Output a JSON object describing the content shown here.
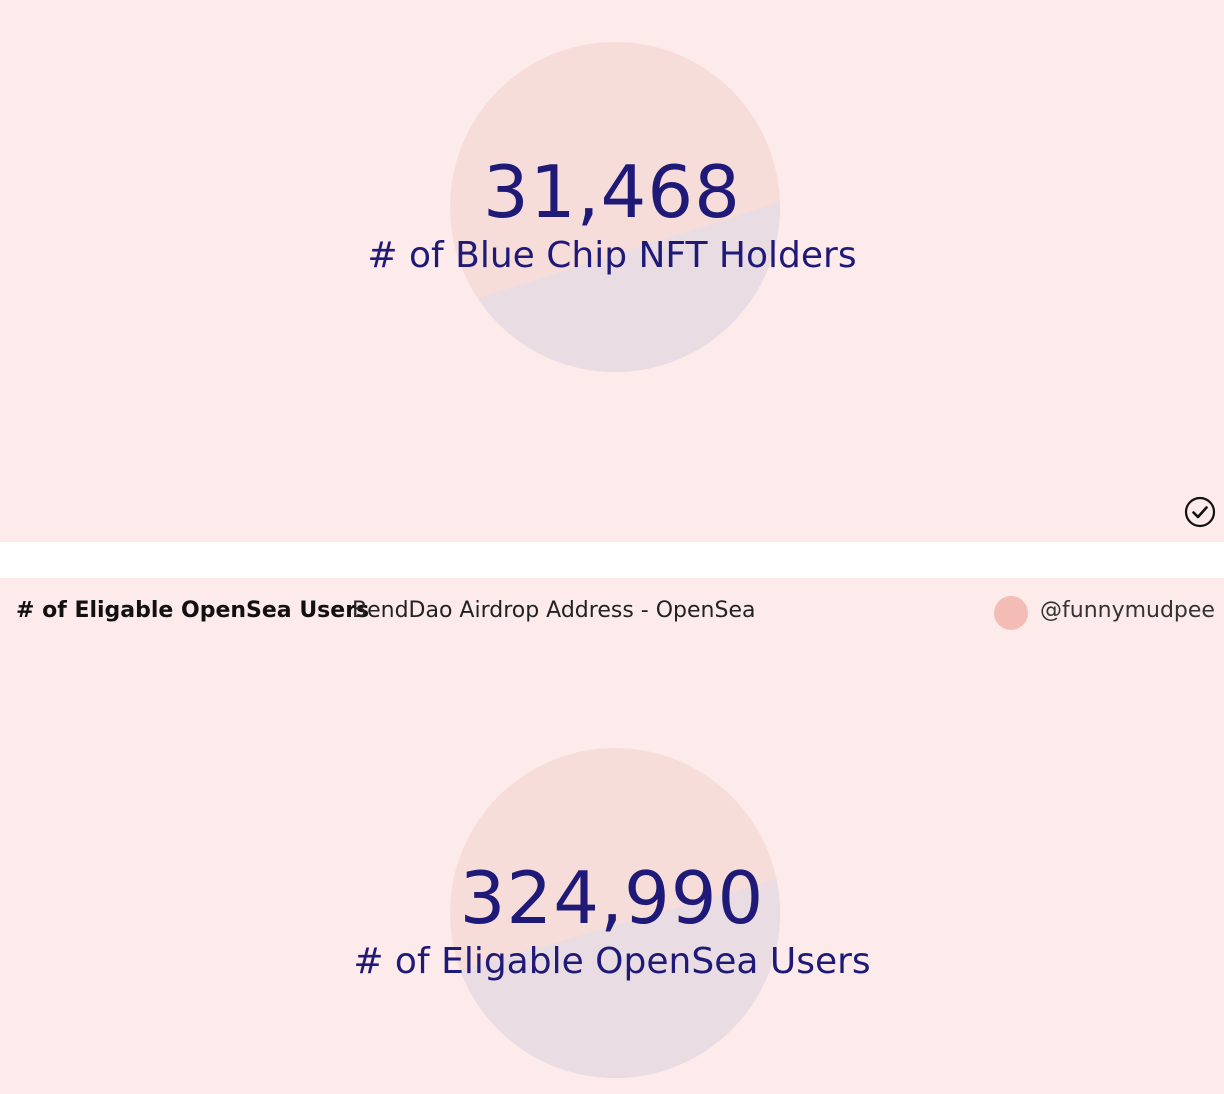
{
  "top_panel": {
    "counter": {
      "value": "31,468",
      "label": "# of Blue Chip NFT Holders"
    },
    "status_icon": "check-circle-icon"
  },
  "bottom_panel": {
    "header": {
      "query_title": "# of Eligable OpenSea Users",
      "query_subtitle": "BendDao Airdrop Address - OpenSea",
      "author_handle": "@funnymudpee",
      "avatar_color": "#f3bdb5"
    },
    "counter": {
      "value": "324,990",
      "label": "# of Eligable OpenSea Users"
    }
  },
  "colors": {
    "panel_background": "#fcebea",
    "counter_text": "#1f1a78",
    "circle_upper": "#f7ddd9",
    "circle_lower": "#e9dce3"
  }
}
